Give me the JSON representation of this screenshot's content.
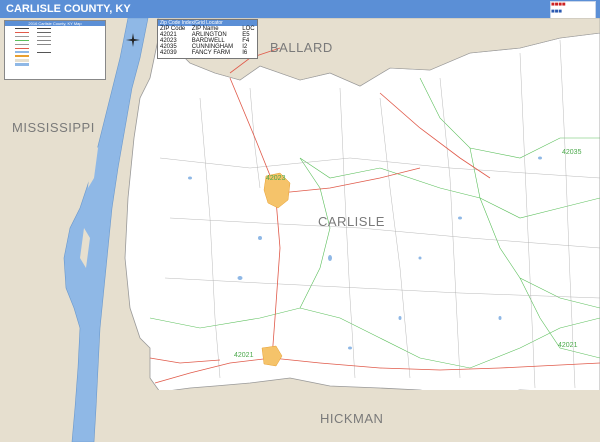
{
  "title": "CARLISLE COUNTY, KY",
  "labels": {
    "mississippi": "MISSISSIPPI",
    "ballard": "BALLARD",
    "carlisle": "CARLISLE",
    "hickman": "HICKMAN"
  },
  "zip_labels": [
    "42023",
    "42035",
    "42021",
    "42021"
  ],
  "legend": {
    "title": "2016 Carlisle County, KY Map"
  },
  "zip_index": {
    "title": "Zip Code Index/Grid Locator",
    "headers": [
      "ZIP Code",
      "ZIP Name",
      "LOC"
    ],
    "rows": [
      [
        "42021",
        "ARLINGTON",
        "E5"
      ],
      [
        "42023",
        "BARDWELL",
        "F4"
      ],
      [
        "42035",
        "CUNNINGHAM",
        "I2"
      ],
      [
        "42039",
        "FANCY FARM",
        "I6"
      ]
    ]
  },
  "colors": {
    "title_bar": "#5b8fd6",
    "water": "#8fb8e6",
    "land_outside": "#e6dfcf",
    "county": "#ffffff",
    "zip_boundary": "#5bbf5b",
    "highway": "#e05a4a",
    "road": "#9a9a9a"
  }
}
